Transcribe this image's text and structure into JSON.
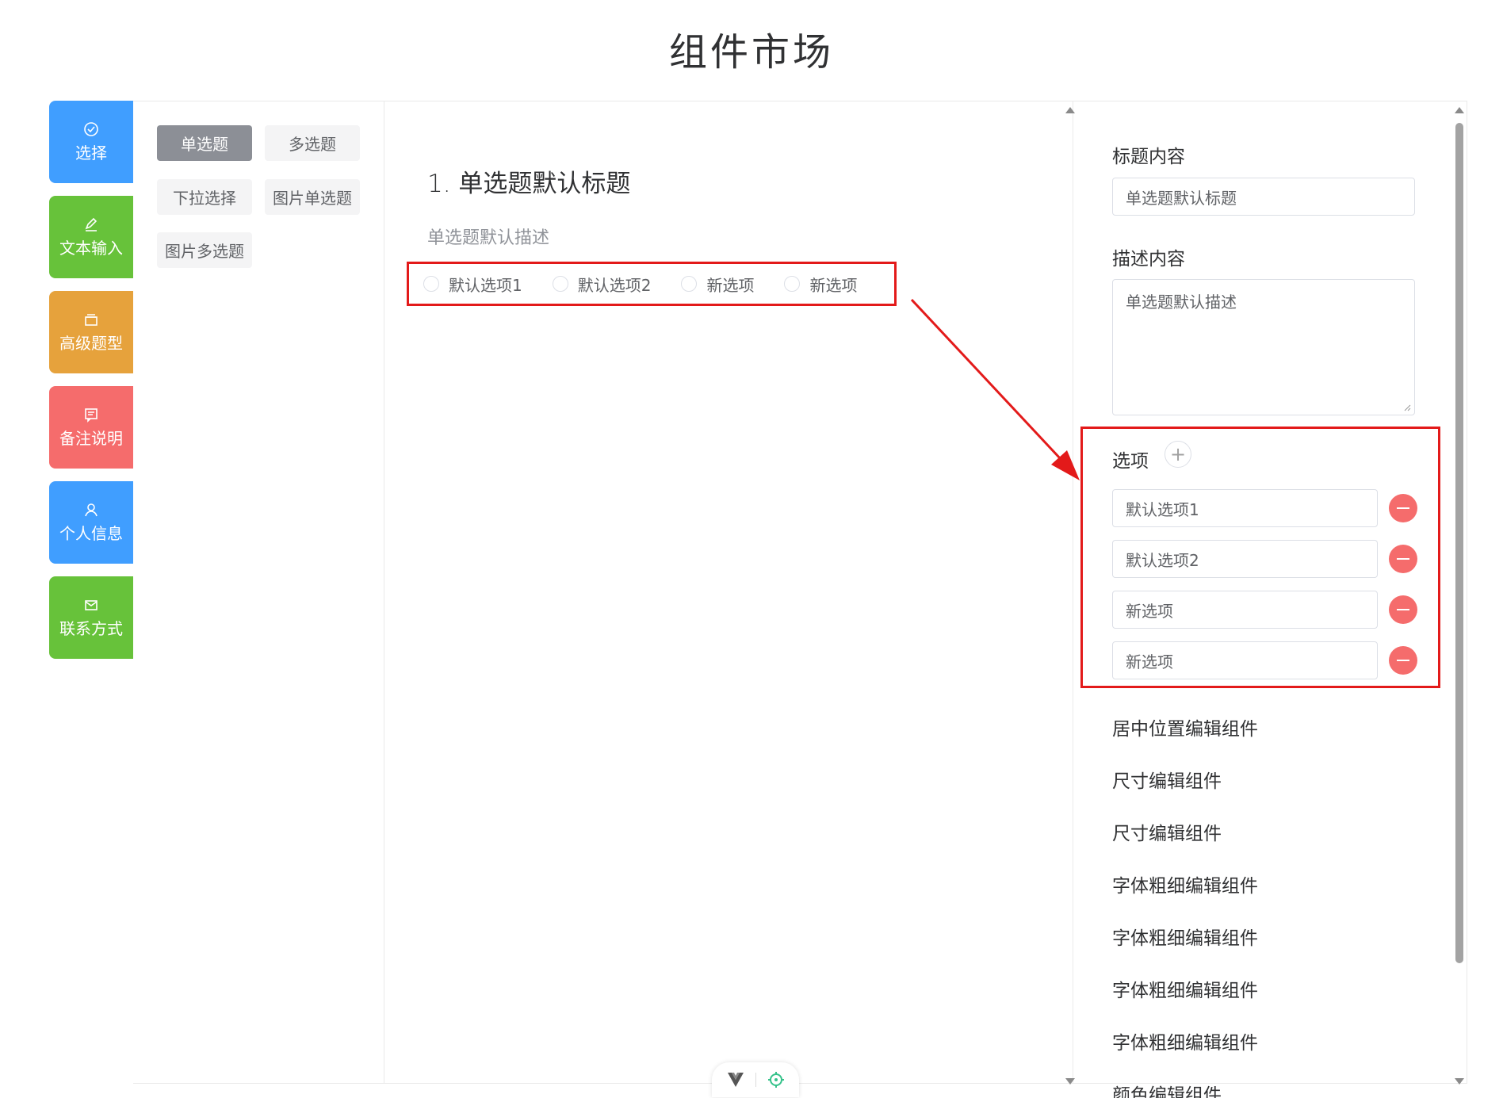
{
  "page": {
    "title": "组件市场"
  },
  "categories": [
    {
      "label": "选择",
      "icon": "check-circle-icon",
      "color": "#409eff"
    },
    {
      "label": "文本输入",
      "icon": "edit-pen-icon",
      "color": "#67c23a"
    },
    {
      "label": "高级题型",
      "icon": "box-icon",
      "color": "#e6a23c"
    },
    {
      "label": "备注说明",
      "icon": "comment-icon",
      "color": "#f56c6c"
    },
    {
      "label": "个人信息",
      "icon": "user-icon",
      "color": "#409eff"
    },
    {
      "label": "联系方式",
      "icon": "mail-icon",
      "color": "#67c23a"
    }
  ],
  "palette": {
    "items": [
      "单选题",
      "多选题",
      "下拉选择",
      "图片单选题",
      "图片多选题"
    ],
    "active": "单选题"
  },
  "canvas": {
    "question_title": "1. 单选题默认标题",
    "question_desc": "单选题默认描述",
    "options": [
      "默认选项1",
      "默认选项2",
      "新选项",
      "新选项"
    ]
  },
  "settings": {
    "title_label": "标题内容",
    "title_value": "单选题默认标题",
    "desc_label": "描述内容",
    "desc_value": "单选题默认描述",
    "options_label": "选项",
    "options": [
      "默认选项1",
      "默认选项2",
      "新选项",
      "新选项"
    ],
    "editors": [
      "居中位置编辑组件",
      "尺寸编辑组件",
      "尺寸编辑组件",
      "字体粗细编辑组件",
      "字体粗细编辑组件",
      "字体粗细编辑组件",
      "字体粗细编辑组件",
      "颜色编辑组件"
    ]
  },
  "colors": {
    "highlight": "#e31a1a",
    "danger": "#f56c6c",
    "primary": "#409eff"
  }
}
